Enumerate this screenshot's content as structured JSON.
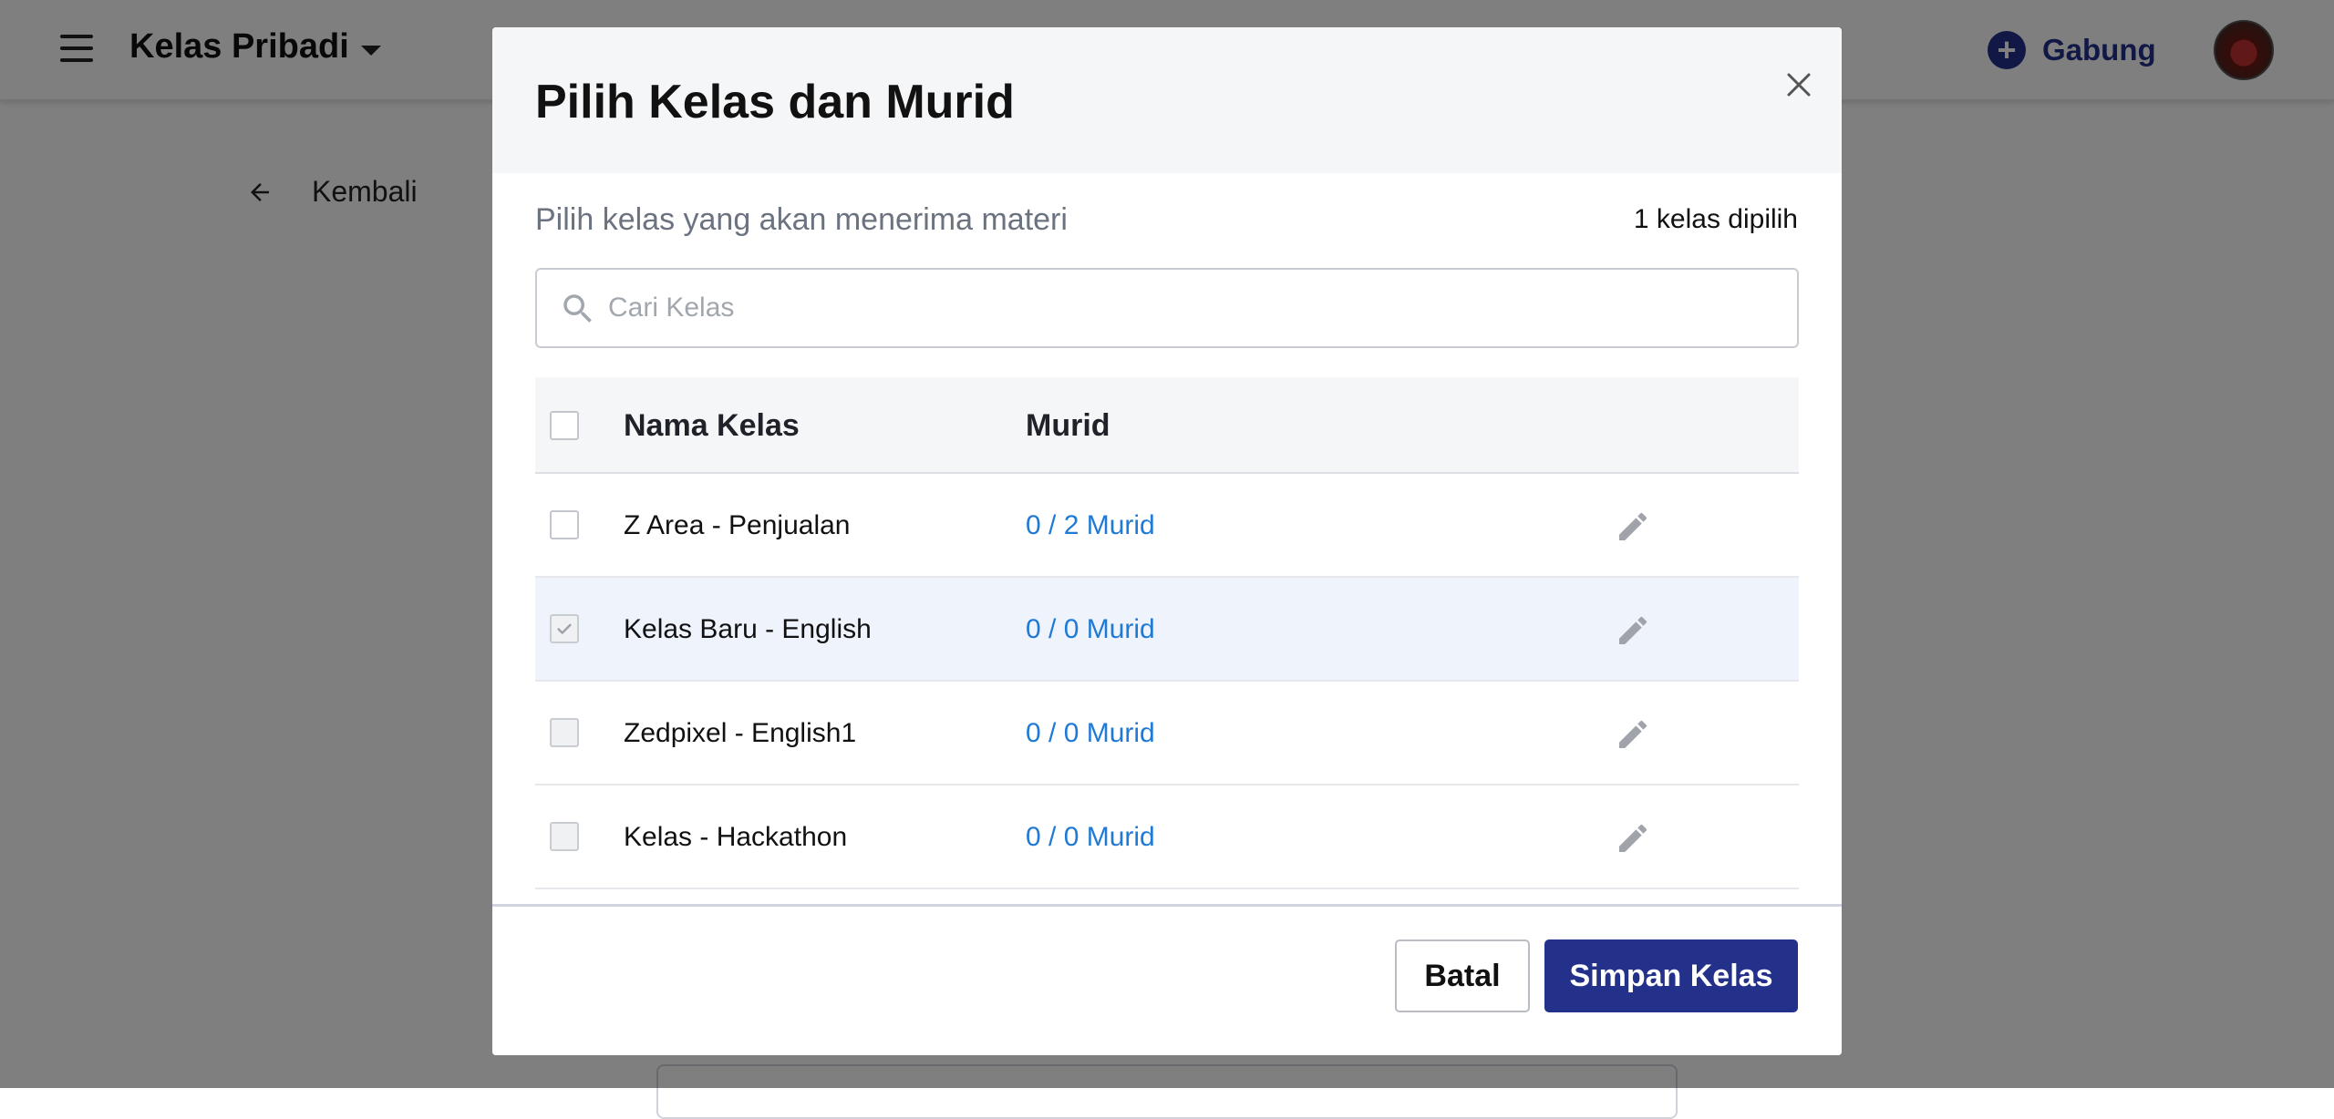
{
  "topbar": {
    "menu_icon": "hamburger-menu-icon",
    "brand": "Kelas Pribadi",
    "join_label": "Gabung",
    "join_icon": "plus-circle-icon",
    "avatar_icon": "user-avatar"
  },
  "page": {
    "back_label": "Kembali",
    "back_icon": "arrow-left-icon"
  },
  "modal": {
    "title": "Pilih Kelas dan Murid",
    "close_icon": "close-icon",
    "subtitle": "Pilih kelas yang akan menerima materi",
    "selected_count": "1 kelas dipilih",
    "search": {
      "placeholder": "Cari Kelas",
      "value": "",
      "icon": "search-icon"
    },
    "table": {
      "headers": {
        "name": "Nama Kelas",
        "murid": "Murid"
      },
      "rows": [
        {
          "name": "Z Area - Penjualan",
          "murid": "0 / 2 Murid",
          "checked": false,
          "disabled": false,
          "highlighted": false
        },
        {
          "name": "Kelas Baru - English",
          "murid": "0 / 0 Murid",
          "checked": true,
          "disabled": true,
          "highlighted": true
        },
        {
          "name": "Zedpixel - English1",
          "murid": "0 / 0 Murid",
          "checked": false,
          "disabled": true,
          "highlighted": false
        },
        {
          "name": "Kelas - Hackathon",
          "murid": "0 / 0 Murid",
          "checked": false,
          "disabled": true,
          "highlighted": false
        }
      ],
      "edit_icon": "pencil-edit-icon"
    },
    "footer": {
      "cancel_label": "Batal",
      "save_label": "Simpan Kelas"
    }
  },
  "colors": {
    "primary": "#23318a",
    "link": "#1f7ad6",
    "row_selected": "#eef3fc",
    "header_bg": "#f5f6f8"
  }
}
